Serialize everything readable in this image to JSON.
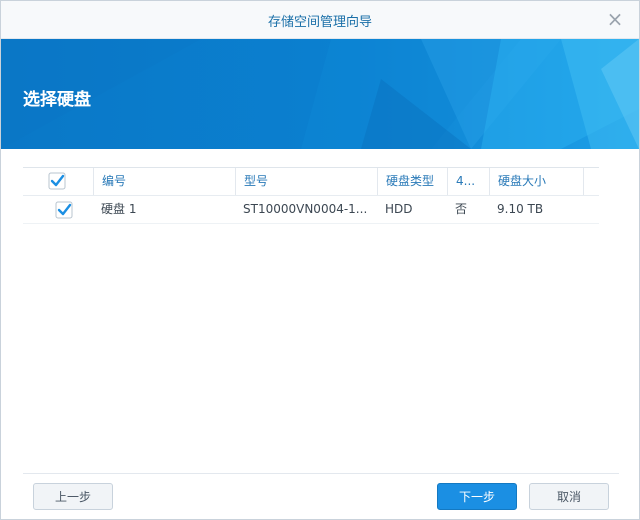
{
  "window": {
    "title": "存储空间管理向导"
  },
  "banner": {
    "heading": "选择硬盘"
  },
  "table": {
    "headers": [
      "编号",
      "型号",
      "硬盘类型",
      "4...",
      "硬盘大小"
    ],
    "rows": [
      {
        "checked": true,
        "number": "硬盘 1",
        "model": "ST10000VN0004-1...",
        "type": "HDD",
        "col4": "否",
        "size": "9.10 TB"
      }
    ]
  },
  "footer": {
    "prev_label": "上一步",
    "next_label": "下一步",
    "cancel_label": "取消"
  },
  "colors": {
    "accent": "#1b8fe3",
    "banner": "#0a78c7",
    "header_text": "#2a7ab8"
  },
  "icons": {
    "close": "close-icon",
    "checkbox": "checkmark-icon"
  }
}
